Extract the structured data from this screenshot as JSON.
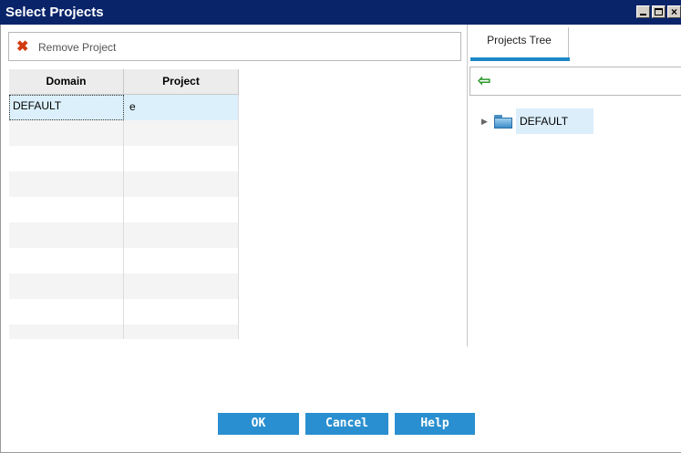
{
  "window": {
    "title": "Select Projects"
  },
  "toolbar": {
    "remove_label": "Remove Project",
    "remove_icon": "x-icon"
  },
  "grid": {
    "columns": [
      "Domain",
      "Project"
    ],
    "rows": [
      {
        "domain": "DEFAULT",
        "project": "e"
      }
    ]
  },
  "tree": {
    "tab_label": "Projects Tree",
    "back_icon": "arrow-left-icon",
    "nodes": [
      {
        "label": "DEFAULT",
        "icon": "folder-icon",
        "expanded": false
      }
    ]
  },
  "buttons": {
    "ok": "OK",
    "cancel": "Cancel",
    "help": "Help"
  },
  "colors": {
    "titlebar": "#0a246a",
    "accent": "#2a8fd0",
    "selection": "#dbf0fa",
    "remove_icon": "#d23b0f"
  }
}
